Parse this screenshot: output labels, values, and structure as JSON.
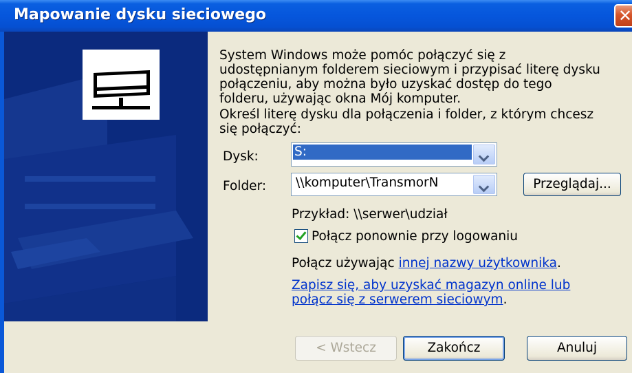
{
  "window": {
    "title": "Mapowanie dysku sieciowego",
    "close_glyph": "✕"
  },
  "intro": {
    "lines": [
      "System Windows może pomóc połączyć się z",
      "udostępnianym folderem sieciowym i przypisać literę dysku",
      "połączeniu, aby można było uzyskać dostęp do tego",
      "folderu, używając okna Mój komputer.",
      "Określ literę dysku dla połączenia i folder, z którym chcesz",
      "się połączyć:"
    ]
  },
  "drive": {
    "label": "Dysk:",
    "value": "S:"
  },
  "folder": {
    "label": "Folder:",
    "value": "\\\\komputer\\TransmorN",
    "browse_label": "Przeglądaj..."
  },
  "example": "Przykład: \\\\serwer\\udział",
  "reconnect": {
    "label": "Połącz ponownie przy logowaniu",
    "checked": true
  },
  "connect_as": {
    "prefix": "Połącz używając ",
    "link": "innej nazwy użytkownika",
    "suffix": "."
  },
  "online": {
    "line1": "Zapisz się, aby uzyskać magazyn online lub",
    "line2": "połącz się z serwerem sieciowym",
    "suffix": "."
  },
  "buttons": {
    "back": "< Wstecz",
    "finish": "Zakończ",
    "cancel": "Anuluj"
  },
  "icons": {
    "banner": "network-drive-icon"
  },
  "colors": {
    "titlebar": "#0656dc",
    "banner": "#0b2a7e",
    "link": "#0033cc",
    "selection": "#316ac5"
  }
}
